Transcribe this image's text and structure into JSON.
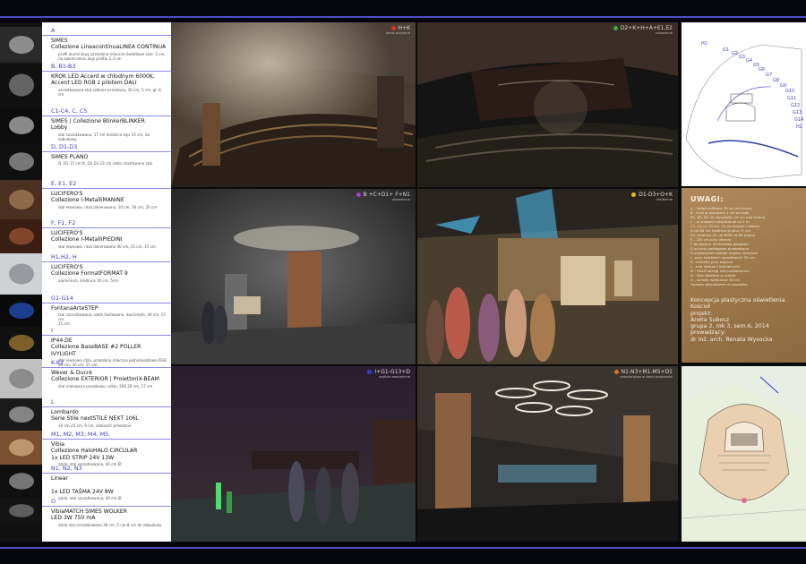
{
  "sections": [
    {
      "code": "A",
      "title": "SIMES\nCollezione LineacontinuaLINEA CONTINUA",
      "desc": "profil  aluminiowy przesłona mleczne świetlowe szer. 3 cm,\nna zakończeniu wąz profilu 2,4 cm"
    },
    {
      "code": "B, B1-B3",
      "title": "KROK LED Accent w chłodnym 6000K,\nAccent LED RGB z pilotem DALI",
      "desc": "szczotkowana stal szklane przesłona, 30 cm, 5 cm, gł. 8 cm"
    },
    {
      "code": "C1-C4, C, C5",
      "title": "SIMES | Collezione BlinkerBLINKER\nLobby",
      "desc": "stal szczotkowana, 17 cm średnica  wys 15 cm, do zabudowy"
    },
    {
      "code": "D, D1-D3",
      "title": "SIMES PLANO",
      "desc": "D, D1 17 cm ft,  D2,D3 22 cm  szkło chartowane  stal"
    },
    {
      "code": "E, E1, E2",
      "title": "LUCIFERO'S\nCollezione I-MetalliMANINE",
      "desc": "stal lewnowa, rdza lakierowana, 10 cm, 30 cm, 20 cm"
    },
    {
      "code": "F, F1, F2",
      "title": "LUCIFERO'S\nCollezione I-MetalliPIEDINI",
      "desc": "stal lewnowa, rdza lakierowana 40 cm, 15 cm, 15 cm"
    },
    {
      "code": "H1,H2, H",
      "title": "LUCIFERO'S\nCollezione FormatFORMAT 9",
      "desc": "aluminium, średnica 10 cm, 5cm"
    },
    {
      "code": "G1-G14",
      "title": "FontanaArteSTEP",
      "desc": "stal szczotkowana, szkło hartowane, dociśnięte, 40 cm, 15 cm\n15 cm"
    },
    {
      "code": "I",
      "title": "IP44.DE\nCollezione BaseBASE #2 POLLER IVYLIGHT",
      "desc": "stal  lewnowa rdza, przesłona mleczna pełnoświatłowa  RGB\n60 cm, 30 cm, 15 cm,"
    },
    {
      "code": "K-K2",
      "title": "Wever & Ducré\nCollezione EXTERIOR | ProiettoriX-BEAM",
      "desc": "stal malowana proszkowo, szkło, 206 20 cm, 17 cm"
    },
    {
      "code": "L",
      "title": "Lombardo\nSerie Stile nextSTILE NEXT 106L",
      "desc": "10 cm 25 cm, 9 cm, zdalność przesłona"
    },
    {
      "code": "M1, M2, M3, M4, M5,",
      "title": "Vibia\nCollezione HaloHALO CIRCULAR\n1x LED STRIP 24V 13W",
      "desc": "szkło, stal szczotkowana, 40 cm Ø"
    },
    {
      "code": "N1, N2, N3",
      "title": "Linear\n\n1x LED TAŚMA 24V 8W",
      "desc": "szkło, stal szczotkowana, 40 cm Ø"
    },
    {
      "code": "O",
      "title": "VibiaMATCH SIMES WOLKER\nLED 3W 750 mA",
      "desc": "szkło stal szczotkowana 30 cm ,5 cm 8 cm do zabudowy"
    }
  ],
  "renders": [
    {
      "code": "H+K",
      "sub": "obraz przyjęcia",
      "dot": "#e0302a"
    },
    {
      "code": "D2+K+H+A+E1,E2",
      "sub": "człowiecze",
      "dot": "#3ab03a"
    },
    {
      "code": "B +C+D1+ F+N1",
      "sub": "oświetlenie",
      "dot": "#a040c0"
    },
    {
      "code": "D1-D3+O+K",
      "sub": "rzeźbienie",
      "dot": "#e0c020"
    },
    {
      "code": "I+G1-G13+D",
      "sub": "wejście zewnętrzne",
      "dot": "#3040d0"
    },
    {
      "code": "N1-N3+M1-M5+D1",
      "sub": "nabożeństwo w dzień powszedni",
      "dot": "#e07020"
    }
  ],
  "panel": {
    "title": "UWAGI:",
    "notes": [
      "A - listwa sufitowa 70 cm od ściany",
      "B - krok w posadzce 1 cm od lądu",
      "B1, B2, B3 na wysokości 10 cm nad ścianą",
      "C - w stropach oświetlenie co 1 m",
      "C1, C2 co 70 cm, C3 na ścianie i ołtarzu",
      "D do 60 cm średnica ściana 17 cm",
      "D1 średnica 20 cm RGB na tle ściany",
      "E - 200 cm przy ołtarzu",
      "F do białych elementów posadzki",
      "G schody podłogowe prowadzące",
      "H zawieszone światło między ścianami",
      "I - przy ścieżkach ogrodowych 30 cm",
      "K - kinkiety przy wejściu",
      "L - nad ławkami kościelnymi",
      "M - HALO okręgi nad prezbiterium",
      "N - linie świetlne w suficie",
      "O - schody wejściowe 30 cm",
      "Oprawy wbudowane w posadzkę"
    ],
    "credits": [
      "Koncepcja plastyczna oświetlenia",
      "Kościoł",
      "projekt:",
      "Aneta Subocz",
      "grupa 2, rok 3, sem.6, 2014",
      "prowadzący:",
      "dr inż. arch. Renata Wysocka"
    ]
  },
  "plan_labels": [
    "H1",
    "G1",
    "G2",
    "G3",
    "G4",
    "G5",
    "G6",
    "G7",
    "G8",
    "G9",
    "G10",
    "G11",
    "G12",
    "G13",
    "G14",
    "H2"
  ],
  "colors": {
    "page": "#05050c",
    "edge": "#4a4fc8",
    "spec_text": "#111111",
    "section_head": "#3a3ad0",
    "panel": "#a07a4e"
  }
}
